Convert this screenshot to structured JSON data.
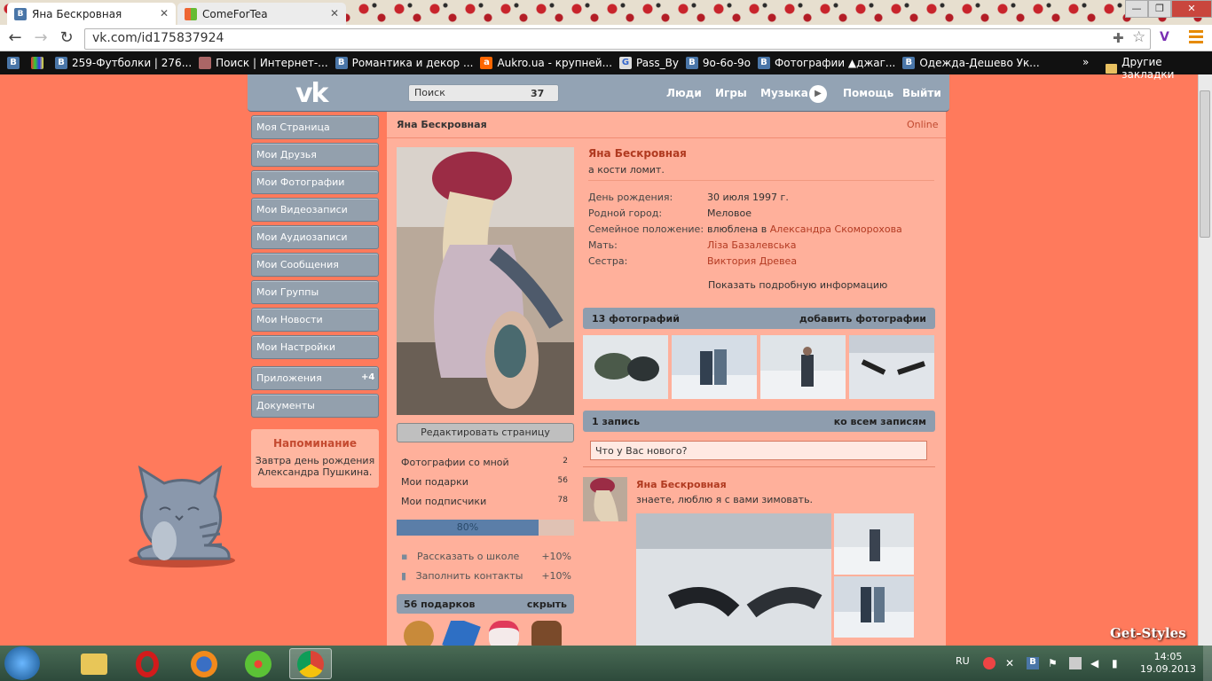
{
  "browser": {
    "tabs": [
      {
        "label": "Яна Бескровная",
        "icon": "vk-favicon"
      },
      {
        "label": "ComeForTea",
        "icon": "windows-favicon"
      }
    ],
    "url": "vk.com/id175837924",
    "bookmarks": [
      {
        "label": "259-Футболки | 276...",
        "icon": "vk-favicon"
      },
      {
        "label": "Поиск | Интернет-...",
        "icon": "avatar-favicon"
      },
      {
        "label": "Романтика и декор ...",
        "icon": "vk-favicon"
      },
      {
        "label": "Aukro.ua - крупней...",
        "icon": "aukro-favicon"
      },
      {
        "label": "Pass_By",
        "icon": "google-favicon"
      },
      {
        "label": "9o-6o-9o",
        "icon": "vk-favicon"
      },
      {
        "label": "Фотографии ▲джаг...",
        "icon": "vk-favicon"
      },
      {
        "label": "Одежда-Дешево Ук...",
        "icon": "vk-favicon"
      }
    ],
    "other_bookmarks": "Другие закладки",
    "chevron": "»"
  },
  "vk": {
    "logo": "vk",
    "search_placeholder": "Поиск",
    "search_count": "37",
    "nav": [
      "Люди",
      "Игры",
      "Музыка",
      "Помощь",
      "Выйти"
    ],
    "menu": [
      "Моя Страница",
      "Мои Друзья",
      "Мои Фотографии",
      "Мои Видеозаписи",
      "Мои Аудиозаписи",
      "Мои Сообщения",
      "Мои Группы",
      "Мои Новости",
      "Мои Настройки",
      "Приложения",
      "Документы"
    ],
    "apps_badge": "+4",
    "reminder": {
      "title": "Напоминание",
      "text_line1": "Завтра день рождения",
      "text_line2": "Александра Пушкина."
    },
    "profile": {
      "header_name": "Яна Бескровная",
      "online": "Online",
      "name": "Яна Бескровная",
      "status": "а кости ломит.",
      "edit": "Редактировать страницу",
      "info": [
        {
          "label": "День рождения:",
          "value": "30 июля 1997 г."
        },
        {
          "label": "Родной город:",
          "value": "Меловое"
        },
        {
          "label": "Семейное положение:",
          "value": "влюблена в ",
          "link": "Александра Скоморохова"
        },
        {
          "label": "Мать:",
          "value": "",
          "link": "Ліза Базалевська"
        },
        {
          "label": "Сестра:",
          "value": "",
          "link": "Виктория Древеа"
        }
      ],
      "more_info": "Показать подробную информацию",
      "stats": [
        {
          "label": "Фотографии со мной",
          "count": "2"
        },
        {
          "label": "Мои подарки",
          "count": "56"
        },
        {
          "label": "Мои подписчики",
          "count": "78"
        }
      ],
      "progress_label": "80%",
      "progress_value": 0.8,
      "tasks": [
        {
          "label": "Рассказать о школе",
          "bonus": "+10%"
        },
        {
          "label": "Заполнить контакты",
          "bonus": "+10%"
        }
      ],
      "gifts": {
        "title": "56 подарков",
        "action": "скрыть"
      },
      "photos": {
        "title": "13 фотографий",
        "action": "добавить фотографии"
      },
      "wall": {
        "title": "1 запись",
        "action": "ко всем записям"
      },
      "new_post_placeholder": "Что у Вас нового?",
      "post": {
        "author": "Яна Бескровная",
        "text": "знаете, люблю я с вами зимовать."
      }
    }
  },
  "watermark": "Get-Styles",
  "taskbar": {
    "lang": "RU",
    "time": "14:05",
    "date": "19.09.2013"
  },
  "colors": {
    "page_bg": "#ff7a5c",
    "content_bg": "#ffb09b",
    "menu": "#93a0ad",
    "link": "#b33a22"
  }
}
